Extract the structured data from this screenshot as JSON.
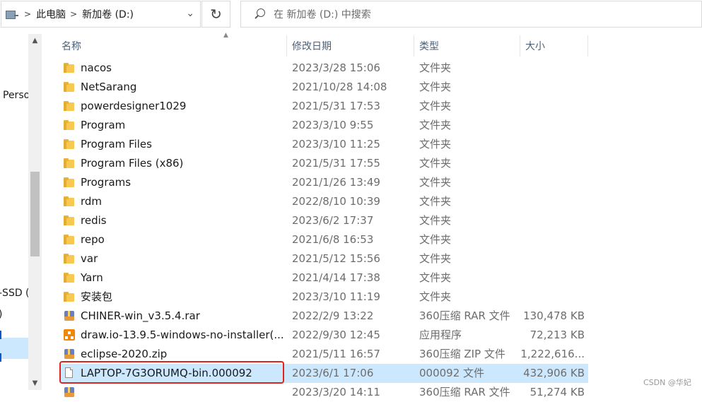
{
  "address": {
    "breadcrumbs": [
      "此电脑",
      "新加卷 (D:)"
    ]
  },
  "search": {
    "placeholder": "在 新加卷 (D:) 中搜索"
  },
  "nav": {
    "fragments": [
      "Perso",
      "-SSD (",
      ")"
    ]
  },
  "columns": {
    "name": "名称",
    "date": "修改日期",
    "type": "类型",
    "size": "大小"
  },
  "files": [
    {
      "name": "nacos",
      "date": "2023/3/28 15:06",
      "type": "文件夹",
      "size": "",
      "icon": "folder-icon"
    },
    {
      "name": "NetSarang",
      "date": "2021/10/28 14:08",
      "type": "文件夹",
      "size": "",
      "icon": "folder-icon"
    },
    {
      "name": "powerdesigner1029",
      "date": "2021/5/31 17:53",
      "type": "文件夹",
      "size": "",
      "icon": "folder-icon"
    },
    {
      "name": "Program",
      "date": "2023/3/10 9:55",
      "type": "文件夹",
      "size": "",
      "icon": "folder-icon"
    },
    {
      "name": "Program Files",
      "date": "2023/3/10 11:25",
      "type": "文件夹",
      "size": "",
      "icon": "folder-icon"
    },
    {
      "name": "Program Files (x86)",
      "date": "2021/5/31 17:55",
      "type": "文件夹",
      "size": "",
      "icon": "folder-icon"
    },
    {
      "name": "Programs",
      "date": "2021/1/26 13:49",
      "type": "文件夹",
      "size": "",
      "icon": "folder-icon"
    },
    {
      "name": "rdm",
      "date": "2022/8/10 10:39",
      "type": "文件夹",
      "size": "",
      "icon": "folder-icon"
    },
    {
      "name": "redis",
      "date": "2023/6/2 17:37",
      "type": "文件夹",
      "size": "",
      "icon": "folder-icon"
    },
    {
      "name": "repo",
      "date": "2021/6/8 16:53",
      "type": "文件夹",
      "size": "",
      "icon": "folder-icon"
    },
    {
      "name": "var",
      "date": "2021/5/12 15:56",
      "type": "文件夹",
      "size": "",
      "icon": "folder-icon"
    },
    {
      "name": "Yarn",
      "date": "2021/4/14 17:38",
      "type": "文件夹",
      "size": "",
      "icon": "folder-icon"
    },
    {
      "name": "安装包",
      "date": "2023/3/10 11:19",
      "type": "文件夹",
      "size": "",
      "icon": "folder-icon"
    },
    {
      "name": "CHINER-win_v3.5.4.rar",
      "date": "2022/2/9 13:22",
      "type": "360压缩 RAR 文件",
      "size": "130,478 KB",
      "icon": "archive-icon"
    },
    {
      "name": "draw.io-13.9.5-windows-no-installer(...",
      "date": "2022/9/30 12:45",
      "type": "应用程序",
      "size": "72,213 KB",
      "icon": "app-icon"
    },
    {
      "name": "eclipse-2020.zip",
      "date": "2021/5/11 16:57",
      "type": "360压缩 ZIP 文件",
      "size": "1,222,616...",
      "icon": "archive-icon"
    },
    {
      "name": "LAPTOP-7G3ORUMQ-bin.000092",
      "date": "2023/6/1 17:06",
      "type": "000092 文件",
      "size": "432,906 KB",
      "icon": "doc-icon",
      "selected": true
    },
    {
      "name": "",
      "date": "2023/3/20 14:11",
      "type": "360压缩 RAR 文件",
      "size": "51,274 KB",
      "icon": "archive-icon"
    }
  ],
  "watermark": "CSDN @华妃"
}
